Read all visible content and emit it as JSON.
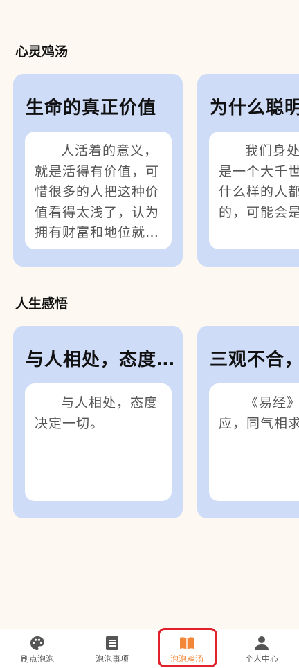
{
  "sections": [
    {
      "title": "心灵鸡汤",
      "cards": [
        {
          "title": "生命的真正价值",
          "text": "人活着的意义，就是活得有价值，可惜很多的人把这种价值看得太浅了，认为拥有财富和地位就是价值"
        },
        {
          "title": "为什么聪明",
          "text": "我们身处的世界，是一个大千世界，所以什么样的人都会存在的，可能会是一样"
        }
      ]
    },
    {
      "title": "人生感悟",
      "cards": [
        {
          "title": "与人相处，态度决定一切",
          "text": "与人相处，态度决定一切。"
        },
        {
          "title": "三观不合，",
          "text": "《易经》「同声相应，同气相求。」"
        }
      ]
    }
  ],
  "tabbar": {
    "items": [
      {
        "label": "刷点泡泡",
        "icon": "palette-icon"
      },
      {
        "label": "泡泡事项",
        "icon": "list-icon"
      },
      {
        "label": "泡泡鸡汤",
        "icon": "book-icon"
      },
      {
        "label": "个人中心",
        "icon": "person-icon"
      }
    ],
    "active_index": 2
  },
  "colors": {
    "background": "#fdf9f2",
    "card": "#cfdcf7",
    "accent": "#f2873a",
    "highlight": "#e0202a"
  }
}
